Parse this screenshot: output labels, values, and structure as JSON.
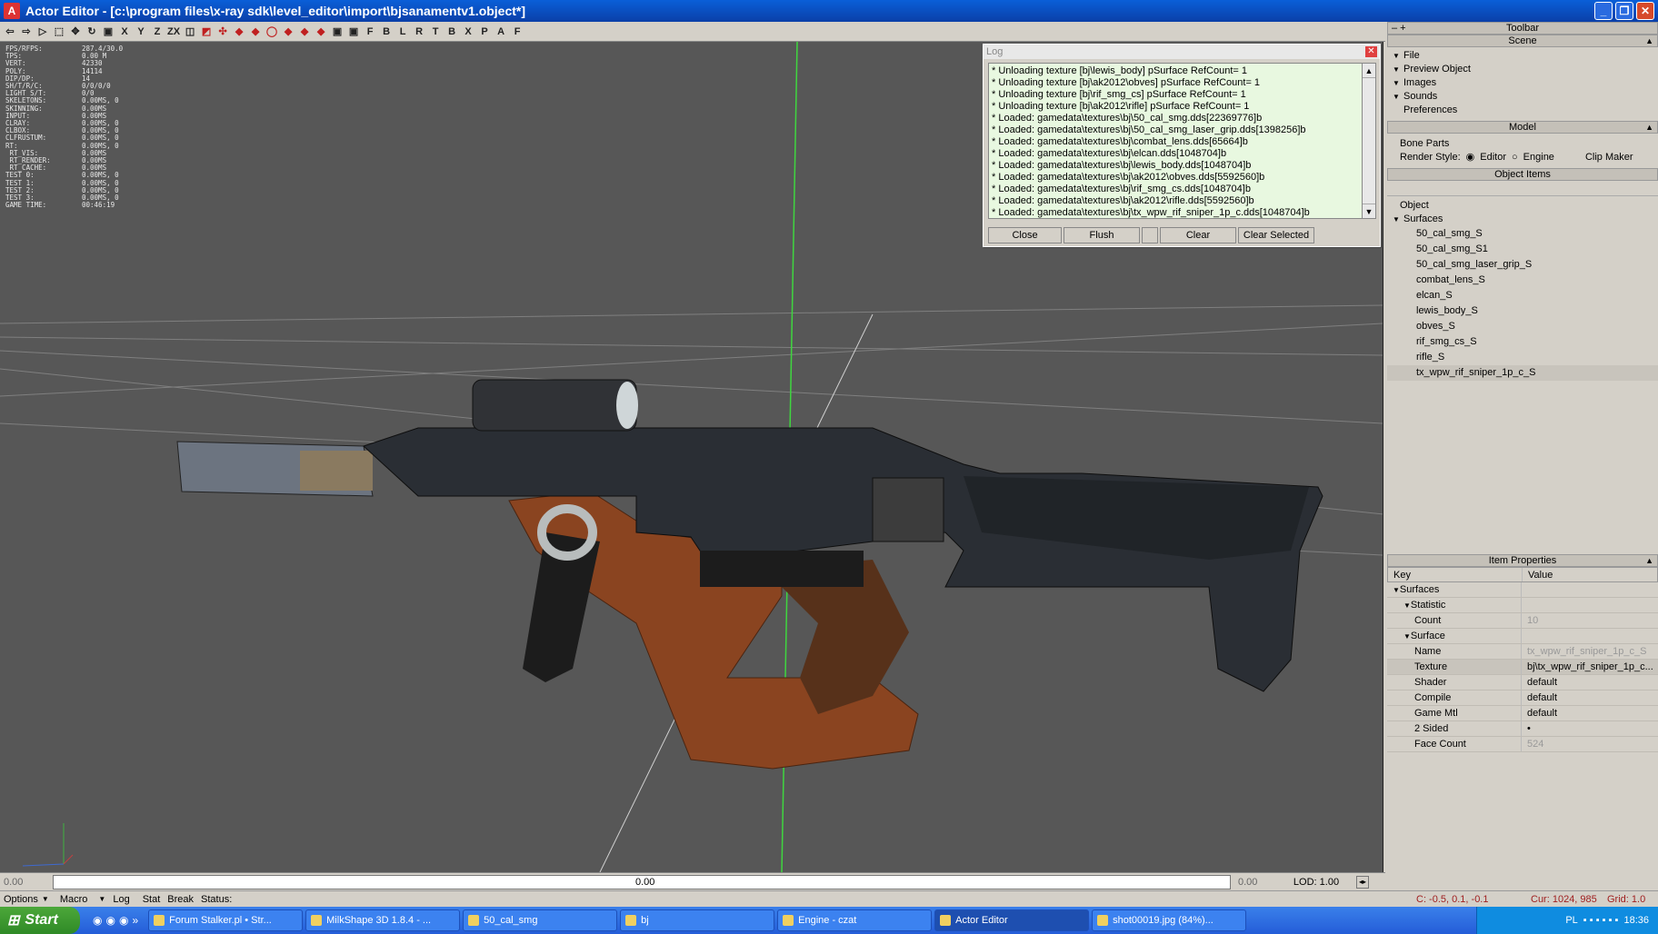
{
  "window": {
    "title": "Actor Editor - [c:\\program files\\x-ray sdk\\level_editor\\import\\bjsanamentv1.object*]",
    "app_icon": "A"
  },
  "toolbar": {
    "glyphs": [
      "⇦",
      "⇨",
      "▷",
      "⬚",
      "✥",
      "↻",
      "▣",
      "X",
      "Y",
      "Z",
      "ZX",
      "◫",
      "◩",
      "✣",
      "◆",
      "◆",
      "◯",
      "◆",
      "◆",
      "◆",
      "▣",
      "▣",
      "F",
      "B",
      "L",
      "R",
      "T",
      "B",
      "X",
      "P",
      "A",
      "F"
    ]
  },
  "stats": [
    [
      "FPS/RFPS:",
      "287.4/30.0"
    ],
    [
      "TPS:",
      "0.00 M"
    ],
    [
      "VERT:",
      "42330"
    ],
    [
      "POLY:",
      "14114"
    ],
    [
      "DIP/DP:",
      "14"
    ],
    [
      "SH/T/R/C:",
      "0/0/0/0"
    ],
    [
      "LIGHT S/T:",
      "0/0"
    ],
    [
      "SKELETONS:",
      "0.00MS, 0"
    ],
    [
      "SKINNING:",
      "0.00MS"
    ],
    [
      "",
      ""
    ],
    [
      "INPUT:",
      "0.00MS"
    ],
    [
      "CLRAY:",
      "0.00MS, 0"
    ],
    [
      "CLBOX:",
      "0.00MS, 0"
    ],
    [
      "CLFRUSTUM:",
      "0.00MS, 0"
    ],
    [
      "",
      ""
    ],
    [
      "RT:",
      "0.00MS, 0"
    ],
    [
      " RT_VIS:",
      "0.00MS"
    ],
    [
      " RT_RENDER:",
      "0.00MS"
    ],
    [
      " RT_CACHE:",
      "0.00MS"
    ],
    [
      "",
      ""
    ],
    [
      "TEST 0:",
      "0.00MS, 0"
    ],
    [
      "TEST 1:",
      "0.00MS, 0"
    ],
    [
      "TEST 2:",
      "0.00MS, 0"
    ],
    [
      "TEST 3:",
      "0.00MS, 0"
    ],
    [
      "",
      ""
    ],
    [
      "GAME TIME:",
      "00:46:19"
    ]
  ],
  "log": {
    "title": "Log",
    "lines": [
      "* Unloading texture [bj\\lewis_body] pSurface RefCount= 1",
      "* Unloading texture [bj\\ak2012\\obves] pSurface RefCount= 1",
      "* Unloading texture [bj\\rif_smg_cs] pSurface RefCount= 1",
      "* Unloading texture [bj\\ak2012\\rifle] pSurface RefCount= 1",
      "* Loaded: gamedata\\textures\\bj\\50_cal_smg.dds[22369776]b",
      "* Loaded: gamedata\\textures\\bj\\50_cal_smg_laser_grip.dds[1398256]b",
      "* Loaded: gamedata\\textures\\bj\\combat_lens.dds[65664]b",
      "* Loaded: gamedata\\textures\\bj\\elcan.dds[1048704]b",
      "* Loaded: gamedata\\textures\\bj\\lewis_body.dds[1048704]b",
      "* Loaded: gamedata\\textures\\bj\\ak2012\\obves.dds[5592560]b",
      "* Loaded: gamedata\\textures\\bj\\rif_smg_cs.dds[1048704]b",
      "* Loaded: gamedata\\textures\\bj\\ak2012\\rifle.dds[5592560]b",
      "* Loaded: gamedata\\textures\\bj\\tx_wpw_rif_sniper_1p_c.dds[1048704]b"
    ],
    "buttons": {
      "close": "Close",
      "flush": "Flush",
      "clear": "Clear",
      "clear_selected": "Clear Selected"
    }
  },
  "panel": {
    "toolbar_label": "Toolbar",
    "scene_label": "Scene",
    "scene_items": [
      "File",
      "Preview Object",
      "Images",
      "Sounds",
      "Preferences"
    ],
    "model_label": "Model",
    "bone_parts": "Bone Parts",
    "render_style": "Render Style:",
    "editor": "Editor",
    "engine": "Engine",
    "clip_maker": "Clip Maker",
    "object_items_label": "Object Items",
    "object": "Object",
    "surfaces": "Surfaces",
    "surface_list": [
      "50_cal_smg_S",
      "50_cal_smg_S1",
      "50_cal_smg_laser_grip_S",
      "combat_lens_S",
      "elcan_S",
      "lewis_body_S",
      "obves_S",
      "rif_smg_cs_S",
      "rifle_S",
      "tx_wpw_rif_sniper_1p_c_S"
    ],
    "item_properties_label": "Item Properties",
    "key": "Key",
    "value": "Value",
    "props": [
      {
        "k": "Surfaces",
        "v": "",
        "indent": 0,
        "tri": true
      },
      {
        "k": "Statistic",
        "v": "",
        "indent": 1,
        "tri": true
      },
      {
        "k": "Count",
        "v": "10",
        "indent": 2,
        "gray": true
      },
      {
        "k": "Surface",
        "v": "",
        "indent": 1,
        "tri": true
      },
      {
        "k": "Name",
        "v": "tx_wpw_rif_sniper_1p_c_S",
        "indent": 2,
        "gray": true
      },
      {
        "k": "Texture",
        "v": "bj\\tx_wpw_rif_sniper_1p_c...",
        "indent": 2,
        "sel": true
      },
      {
        "k": "Shader",
        "v": "default",
        "indent": 2
      },
      {
        "k": "Compile",
        "v": "default",
        "indent": 2
      },
      {
        "k": "Game Mtl",
        "v": "default",
        "indent": 2
      },
      {
        "k": "2 Sided",
        "v": "•",
        "indent": 2
      },
      {
        "k": "Face Count",
        "v": "524",
        "indent": 2,
        "gray": true
      }
    ]
  },
  "timeline": {
    "start": "0.00",
    "mid": "0.00",
    "end": "0.00",
    "lod": "LOD: 1.00"
  },
  "statusbar": {
    "options": "Options",
    "macro": "Macro",
    "log": "Log",
    "stat": "Stat",
    "break": "Break",
    "status": "Status:",
    "coords": "C: -0.5, 0.1, -0.1",
    "cursor": "Cur: 1024, 985",
    "grid": "Grid: 1.0"
  },
  "taskbar": {
    "start": "Start",
    "tasks": [
      "Forum Stalker.pl • Str...",
      "MilkShape 3D 1.8.4 - ...",
      "50_cal_smg",
      "bj",
      "Engine - czat",
      "Actor Editor",
      "shot00019.jpg (84%)..."
    ],
    "lang": "PL",
    "clock": "18:36"
  },
  "colors": {
    "viewport": "#575757",
    "log_bg": "#e8f8e0",
    "titlebar": "#0a4fc8",
    "wood": "#8a4420"
  }
}
